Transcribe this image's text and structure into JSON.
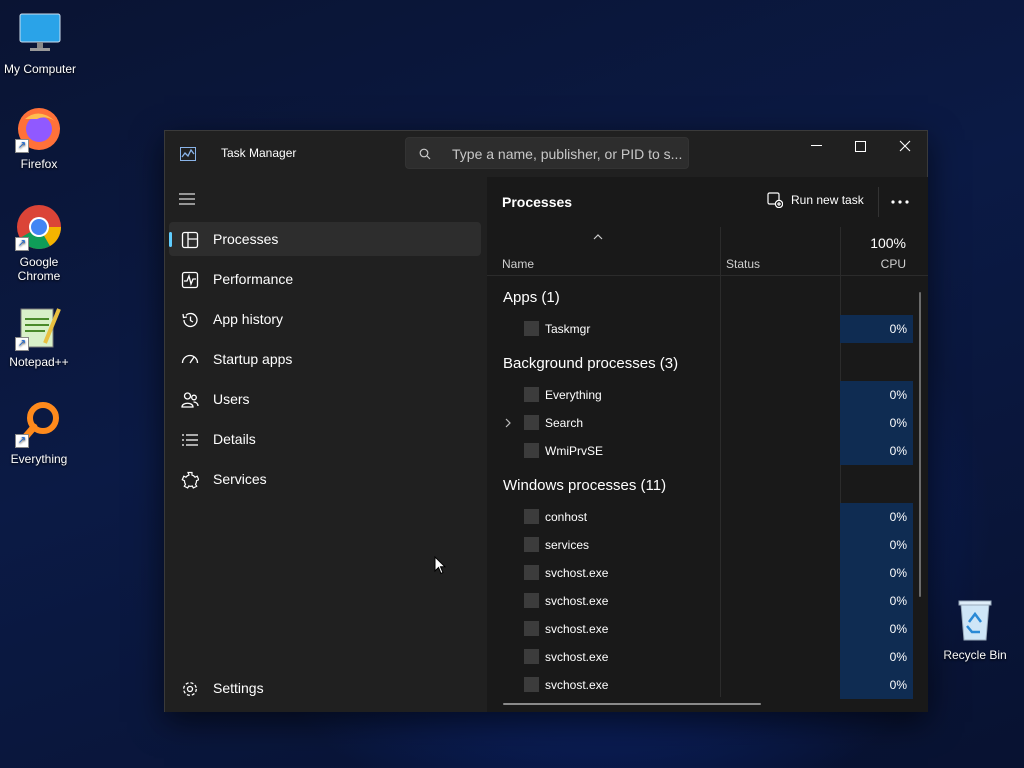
{
  "desktop": {
    "icons": [
      {
        "label": "My Computer",
        "icon": "monitor-icon"
      },
      {
        "label": "Firefox",
        "icon": "firefox-icon"
      },
      {
        "label": "Google Chrome",
        "icon": "chrome-icon"
      },
      {
        "label": "Notepad++",
        "icon": "notepadpp-icon"
      },
      {
        "label": "Everything",
        "icon": "everything-icon"
      },
      {
        "label": "Recycle Bin",
        "icon": "recycle-bin-icon"
      }
    ]
  },
  "window": {
    "title": "Task Manager",
    "search_placeholder": "Type a name, publisher, or PID to s..."
  },
  "sidebar": {
    "items": [
      {
        "label": "Processes",
        "icon": "processes-icon",
        "active": true
      },
      {
        "label": "Performance",
        "icon": "performance-icon"
      },
      {
        "label": "App history",
        "icon": "history-icon"
      },
      {
        "label": "Startup apps",
        "icon": "startup-icon"
      },
      {
        "label": "Users",
        "icon": "users-icon"
      },
      {
        "label": "Details",
        "icon": "details-icon"
      },
      {
        "label": "Services",
        "icon": "services-icon"
      }
    ],
    "settings": {
      "label": "Settings",
      "icon": "gear-icon"
    }
  },
  "main": {
    "title": "Processes",
    "run_new_task": "Run new task",
    "columns": {
      "name": "Name",
      "status": "Status",
      "cpu_total": "100%",
      "cpu": "CPU"
    },
    "groups": [
      {
        "title": "Apps (1)",
        "processes": [
          {
            "name": "Taskmgr",
            "cpu": "0%"
          }
        ]
      },
      {
        "title": "Background processes (3)",
        "processes": [
          {
            "name": "Everything",
            "cpu": "0%"
          },
          {
            "name": "Search",
            "cpu": "0%",
            "expandable": true
          },
          {
            "name": "WmiPrvSE",
            "cpu": "0%"
          }
        ]
      },
      {
        "title": "Windows processes (11)",
        "processes": [
          {
            "name": "conhost",
            "cpu": "0%"
          },
          {
            "name": "services",
            "cpu": "0%"
          },
          {
            "name": "svchost.exe",
            "cpu": "0%"
          },
          {
            "name": "svchost.exe",
            "cpu": "0%"
          },
          {
            "name": "svchost.exe",
            "cpu": "0%"
          },
          {
            "name": "svchost.exe",
            "cpu": "0%"
          },
          {
            "name": "svchost.exe",
            "cpu": "0%"
          }
        ]
      }
    ]
  },
  "colors": {
    "accent": "#60cdff",
    "cpu_cell": "#0f2c52"
  }
}
